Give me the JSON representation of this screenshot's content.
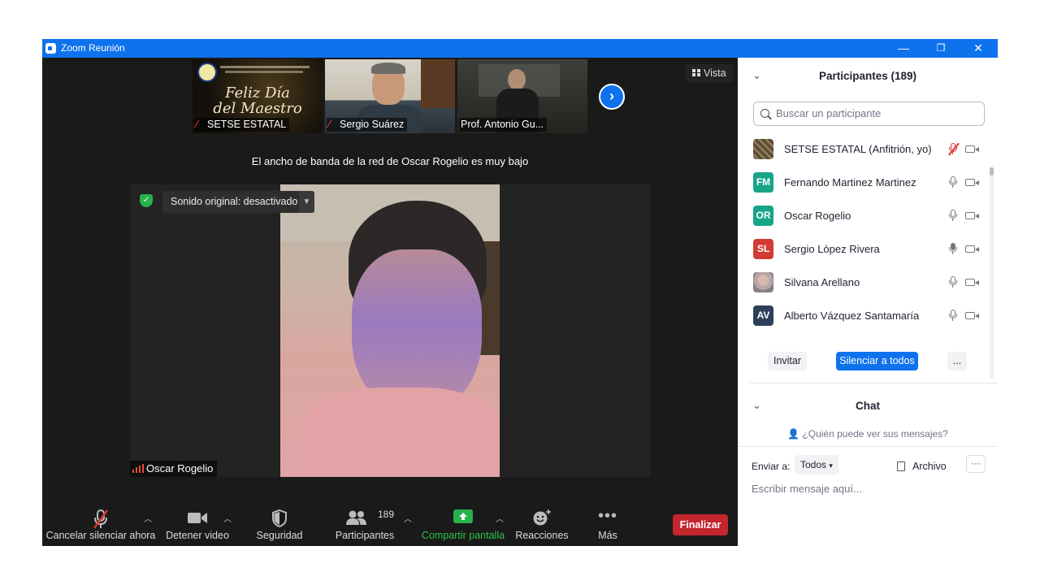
{
  "window": {
    "title": "Zoom Reunión",
    "minimize_icon": "—",
    "restore_icon": "❐",
    "close_icon": "✕"
  },
  "stage": {
    "view_label": "Vista",
    "bandwidth_warning": "El ancho de banda de la red de Oscar Rogelio es muy bajo",
    "thumbnails": [
      {
        "name": "SETSE ESTATAL",
        "muted": true,
        "card_line1": "Feliz Día",
        "card_line2": "del Maestro"
      },
      {
        "name": "Sergio Suárez",
        "muted": true
      },
      {
        "name": "Prof. Antonio Gu...",
        "muted": false
      }
    ],
    "main_video": {
      "sound_label": "Sonido original: desactivado",
      "speaker_name": "Oscar Rogelio"
    }
  },
  "toolbar": {
    "mute_label": "Cancelar silenciar ahora",
    "video_label": "Detener video",
    "security_label": "Seguridad",
    "participants_label": "Participantes",
    "participants_count": "189",
    "share_label": "Compartir pantalla",
    "reactions_label": "Reacciones",
    "more_label": "Más",
    "end_label": "Finalizar",
    "share_color": "#27b14b",
    "end_color": "#c4262e"
  },
  "participants_panel": {
    "title": "Participantes (189)",
    "search_placeholder": "Buscar un participante",
    "people": [
      {
        "initials": "",
        "name": "SETSE ESTATAL (Anfitrión, yo)",
        "color": "#6b5a3e",
        "mic_muted": true
      },
      {
        "initials": "FM",
        "name": "Fernando Martinez Martinez",
        "color": "#17a589",
        "mic_muted": false
      },
      {
        "initials": "OR",
        "name": "Oscar Rogelio",
        "color": "#17a589",
        "mic_muted": false
      },
      {
        "initials": "SL",
        "name": "Sergio Lòpez Rivera",
        "color": "#d13c32",
        "mic_muted": false
      },
      {
        "initials": "",
        "name": "Silvana Arellano",
        "color": "#b9a6a0",
        "mic_muted": false
      },
      {
        "initials": "AV",
        "name": "Alberto Vázquez Santamaría",
        "color": "#2d4059",
        "mic_muted": false
      }
    ],
    "invite_label": "Invitar",
    "mute_all_label": "Silenciar a todos",
    "more_label": "..."
  },
  "chat_panel": {
    "title": "Chat",
    "who_can_see": "¿Quién puede ver sus mensajes?",
    "send_to_label": "Enviar a:",
    "send_to_value": "Todos",
    "file_label": "Archivo",
    "more_label": "···",
    "input_placeholder": "Escribir mensaje aquí..."
  }
}
